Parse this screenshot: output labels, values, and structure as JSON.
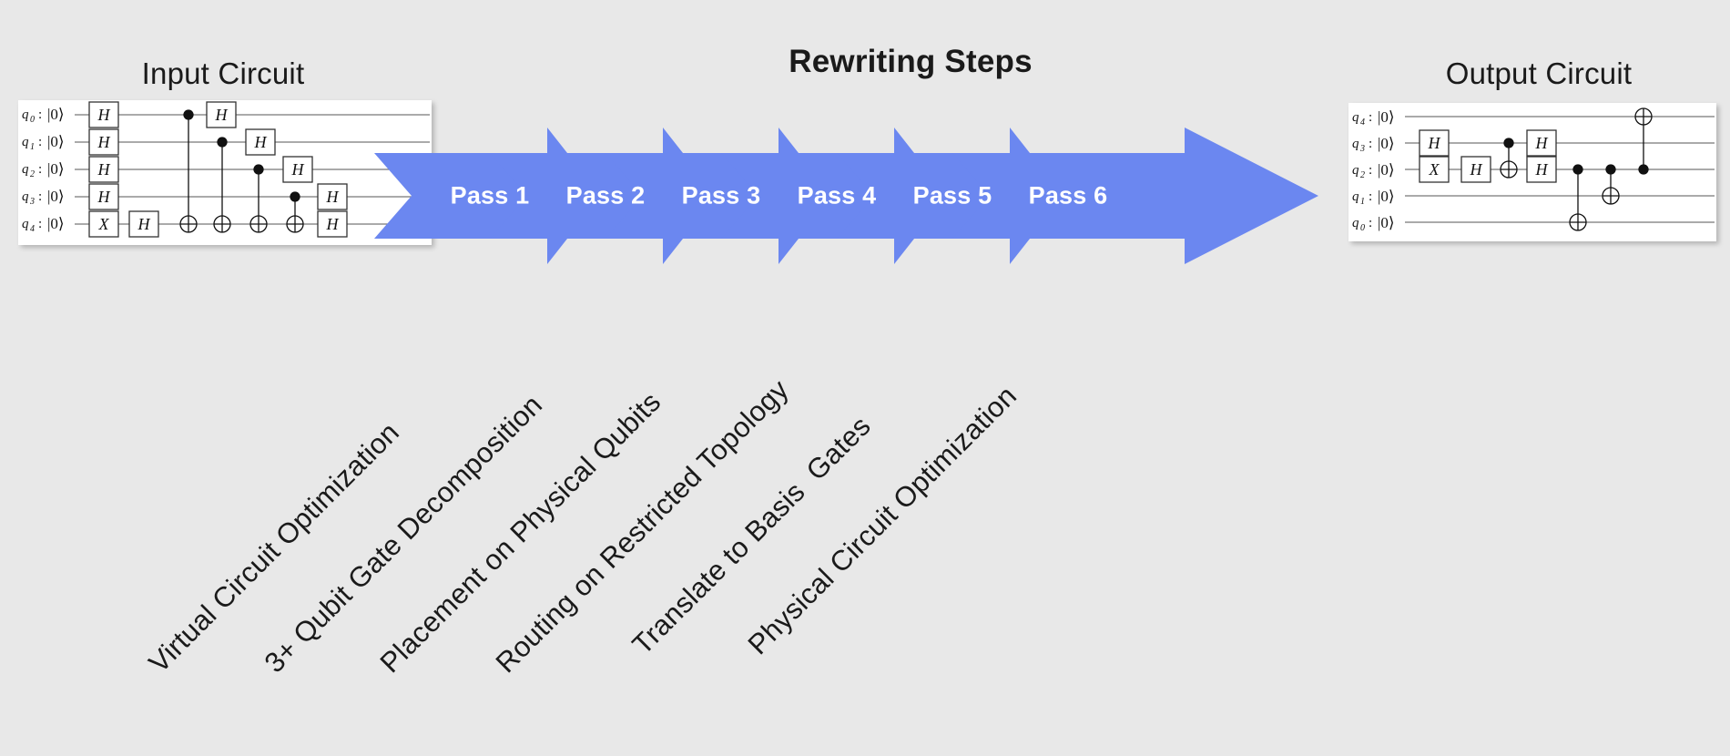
{
  "background_color": "#e8e8e8",
  "accent_color": "#6b87f0",
  "panel_color": "#ffffff",
  "header": {
    "main_title": "Rewriting Steps",
    "input_title": "Input Circuit",
    "output_title": "Output Circuit"
  },
  "passes": [
    {
      "label": "Pass 1"
    },
    {
      "label": "Pass 2"
    },
    {
      "label": "Pass 3"
    },
    {
      "label": "Pass 4"
    },
    {
      "label": "Pass 5"
    },
    {
      "label": "Pass 6"
    }
  ],
  "steps": [
    {
      "label": "Virtual Circuit Optimization"
    },
    {
      "label": "3+ Qubit Gate Decomposition"
    },
    {
      "label": "Placement on Physical Qubits"
    },
    {
      "label": "Routing on Restricted Topology"
    },
    {
      "label": "Translate to Basis  Gates"
    },
    {
      "label": "Physical Circuit Optimization"
    }
  ],
  "input_circuit": {
    "qubits": [
      "q0",
      "q1",
      "q2",
      "q3",
      "q4"
    ],
    "ket": "|0⟩",
    "gates": [
      {
        "type": "H",
        "qubit": 0,
        "column": 0
      },
      {
        "type": "H",
        "qubit": 1,
        "column": 0
      },
      {
        "type": "H",
        "qubit": 2,
        "column": 0
      },
      {
        "type": "H",
        "qubit": 3,
        "column": 0
      },
      {
        "type": "X",
        "qubit": 4,
        "column": 0
      },
      {
        "type": "H",
        "qubit": 4,
        "column": 1
      },
      {
        "type": "CX",
        "control": 0,
        "target": 4,
        "column": 2
      },
      {
        "type": "H",
        "qubit": 0,
        "column": 3
      },
      {
        "type": "CX",
        "control": 1,
        "target": 4,
        "column": 3
      },
      {
        "type": "H",
        "qubit": 1,
        "column": 4
      },
      {
        "type": "CX",
        "control": 2,
        "target": 4,
        "column": 4
      },
      {
        "type": "H",
        "qubit": 2,
        "column": 5
      },
      {
        "type": "CX",
        "control": 3,
        "target": 4,
        "column": 5
      },
      {
        "type": "H",
        "qubit": 3,
        "column": 6
      },
      {
        "type": "H",
        "qubit": 4,
        "column": 6
      }
    ]
  },
  "output_circuit": {
    "qubits": [
      "q4",
      "q3",
      "q2",
      "q1",
      "q0"
    ],
    "ket": "|0⟩",
    "gates": [
      {
        "type": "H",
        "row": 1,
        "column": 0
      },
      {
        "type": "X",
        "row": 2,
        "column": 0
      },
      {
        "type": "H",
        "row": 2,
        "column": 1
      },
      {
        "type": "CX",
        "control_row": 1,
        "target_row": 2,
        "column": 2
      },
      {
        "type": "H",
        "row": 1,
        "column": 3
      },
      {
        "type": "H",
        "row": 2,
        "column": 3
      },
      {
        "type": "CX",
        "control_row": 2,
        "target_row": 4,
        "column": 4
      },
      {
        "type": "CX",
        "control_row": 2,
        "target_row": 3,
        "column": 5
      },
      {
        "type": "CX",
        "control_row": 2,
        "target_row": 0,
        "column": 6
      }
    ]
  }
}
